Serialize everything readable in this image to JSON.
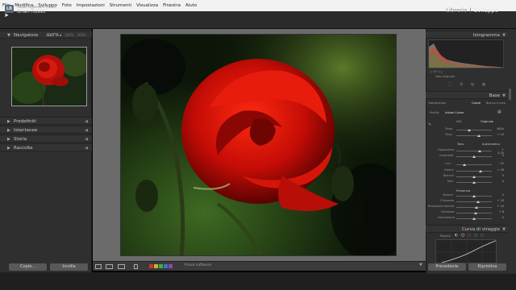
{
  "menubar": [
    "File",
    "Modifica",
    "Sviluppo",
    "Foto",
    "Impostazioni",
    "Strumenti",
    "Visualizza",
    "Finestra",
    "Aiuto"
  ],
  "identity": {
    "badge": "LR",
    "app_subtitle": "Adobe Lightroom Classic",
    "user": "Brian Russo"
  },
  "modules": {
    "library": "Libreria",
    "develop": "Sviluppo",
    "separator": "|",
    "active": "Sviluppo"
  },
  "left_panel": {
    "navigator": {
      "title": "Navigatore",
      "zoom_options": [
        "ADATTA ▾",
        "100%",
        "300%"
      ],
      "selected_zoom": "ADATTA ▾"
    },
    "sections": [
      "Predefiniti",
      "Istantanee",
      "Storia",
      "Raccolte"
    ],
    "copy_label": "Copia...",
    "paste_label": "Incolla"
  },
  "toolbar": {
    "soft_proof_label": "Prova software"
  },
  "right_panel": {
    "histogram": {
      "title": "Istogramma",
      "info": "◻  ISO   ƒ   ◻",
      "original_label": "Foto originale"
    },
    "basic": {
      "title": "Base",
      "treatment": {
        "label": "Trattamento:",
        "color": "Colore",
        "bw": "Bianco e nero"
      },
      "profile": {
        "label": "Profilo:",
        "value": "Adobe Colore"
      },
      "wb": {
        "label": "WB:",
        "value": "Originale"
      },
      "temp": {
        "label": "Temp",
        "value": "4800"
      },
      "tint": {
        "label": "Tinta",
        "value": "+ 10"
      },
      "tone": {
        "label": "Tono",
        "auto": "Automatico"
      },
      "sliders": [
        {
          "label": "Esposizione",
          "value": "+ 0,25"
        },
        {
          "label": "Contrasto",
          "value": "0"
        },
        {
          "label": "Luci",
          "value": "- 52"
        },
        {
          "label": "Ombre",
          "value": "+ 28"
        },
        {
          "label": "Bianchi",
          "value": "0"
        },
        {
          "label": "Neri",
          "value": "0"
        }
      ],
      "presence": {
        "label": "Presenza"
      },
      "presence_sliders": [
        {
          "label": "Texture",
          "value": "0"
        },
        {
          "label": "Chiarezza",
          "value": "+ 18"
        },
        {
          "label": "Rimozione foschia",
          "value": "+ 10"
        },
        {
          "label": "Vividezza",
          "value": "+ 8"
        },
        {
          "label": "Saturazione",
          "value": "0"
        }
      ]
    },
    "tone_curve": {
      "title": "Curva di viraggio",
      "region": "Regioni"
    },
    "previous_label": "Precedente",
    "reset_label": "Ripristina"
  },
  "colors": {
    "accent": "#7a9cb8",
    "flag_red": "#cc3333",
    "flag_yellow": "#c9b333",
    "flag_green": "#44aa44",
    "flag_blue": "#3377cc",
    "flag_purple": "#9944aa"
  }
}
